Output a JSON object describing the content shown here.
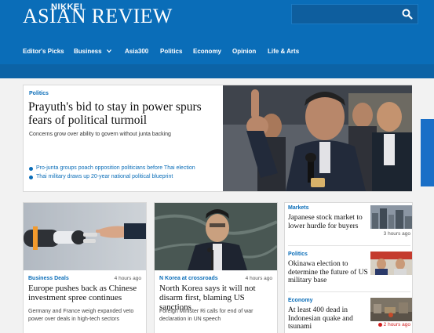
{
  "header": {
    "logo_small": "NIKKEI",
    "logo_big": "ASIAN REVIEW",
    "search_placeholder": "",
    "brand_color": "#0a6db8",
    "search_icon": "search-icon"
  },
  "nav": {
    "items": [
      {
        "label": "Editor's Picks"
      },
      {
        "label": "Business",
        "has_dropdown": true
      },
      {
        "label": "Asia300"
      },
      {
        "label": "Politics"
      },
      {
        "label": "Economy"
      },
      {
        "label": "Opinion"
      },
      {
        "label": "Life & Arts"
      }
    ]
  },
  "top_story": {
    "category": "Politics",
    "headline": "Prayuth's bid to stay in power spurs fears of political turmoil",
    "subhead": "Concerns grow over ability to govern without junta backing",
    "related": [
      "Pro-junta groups poach opposition politicians before Thai election",
      "Thai military draws up 20-year national political blueprint"
    ]
  },
  "cards": [
    {
      "category": "Business Deals",
      "time": "4 hours ago",
      "headline": "Europe pushes back as Chinese investment spree continues",
      "subhead": "Germany and France weigh expanded veto power over deals in high-tech sectors"
    },
    {
      "category": "N Korea at crossroads",
      "time": "4 hours ago",
      "headline": "North Korea says it will not disarm first, blaming US sanctions",
      "subhead": "Foreign Minister Ri calls for end of war declaration in UN speech"
    }
  ],
  "right_column": [
    {
      "category": "Markets",
      "headline": "Japanese stock market to lower hurdle for buyers",
      "time": "3 hours ago",
      "breaking": false
    },
    {
      "category": "Politics",
      "headline": "Okinawa election to determine the future of US military base",
      "time": "",
      "breaking": false
    },
    {
      "category": "Economy",
      "headline": "At least 400 dead in Indonesian quake and tsunami",
      "time": "2 hours ago",
      "breaking": true
    }
  ]
}
